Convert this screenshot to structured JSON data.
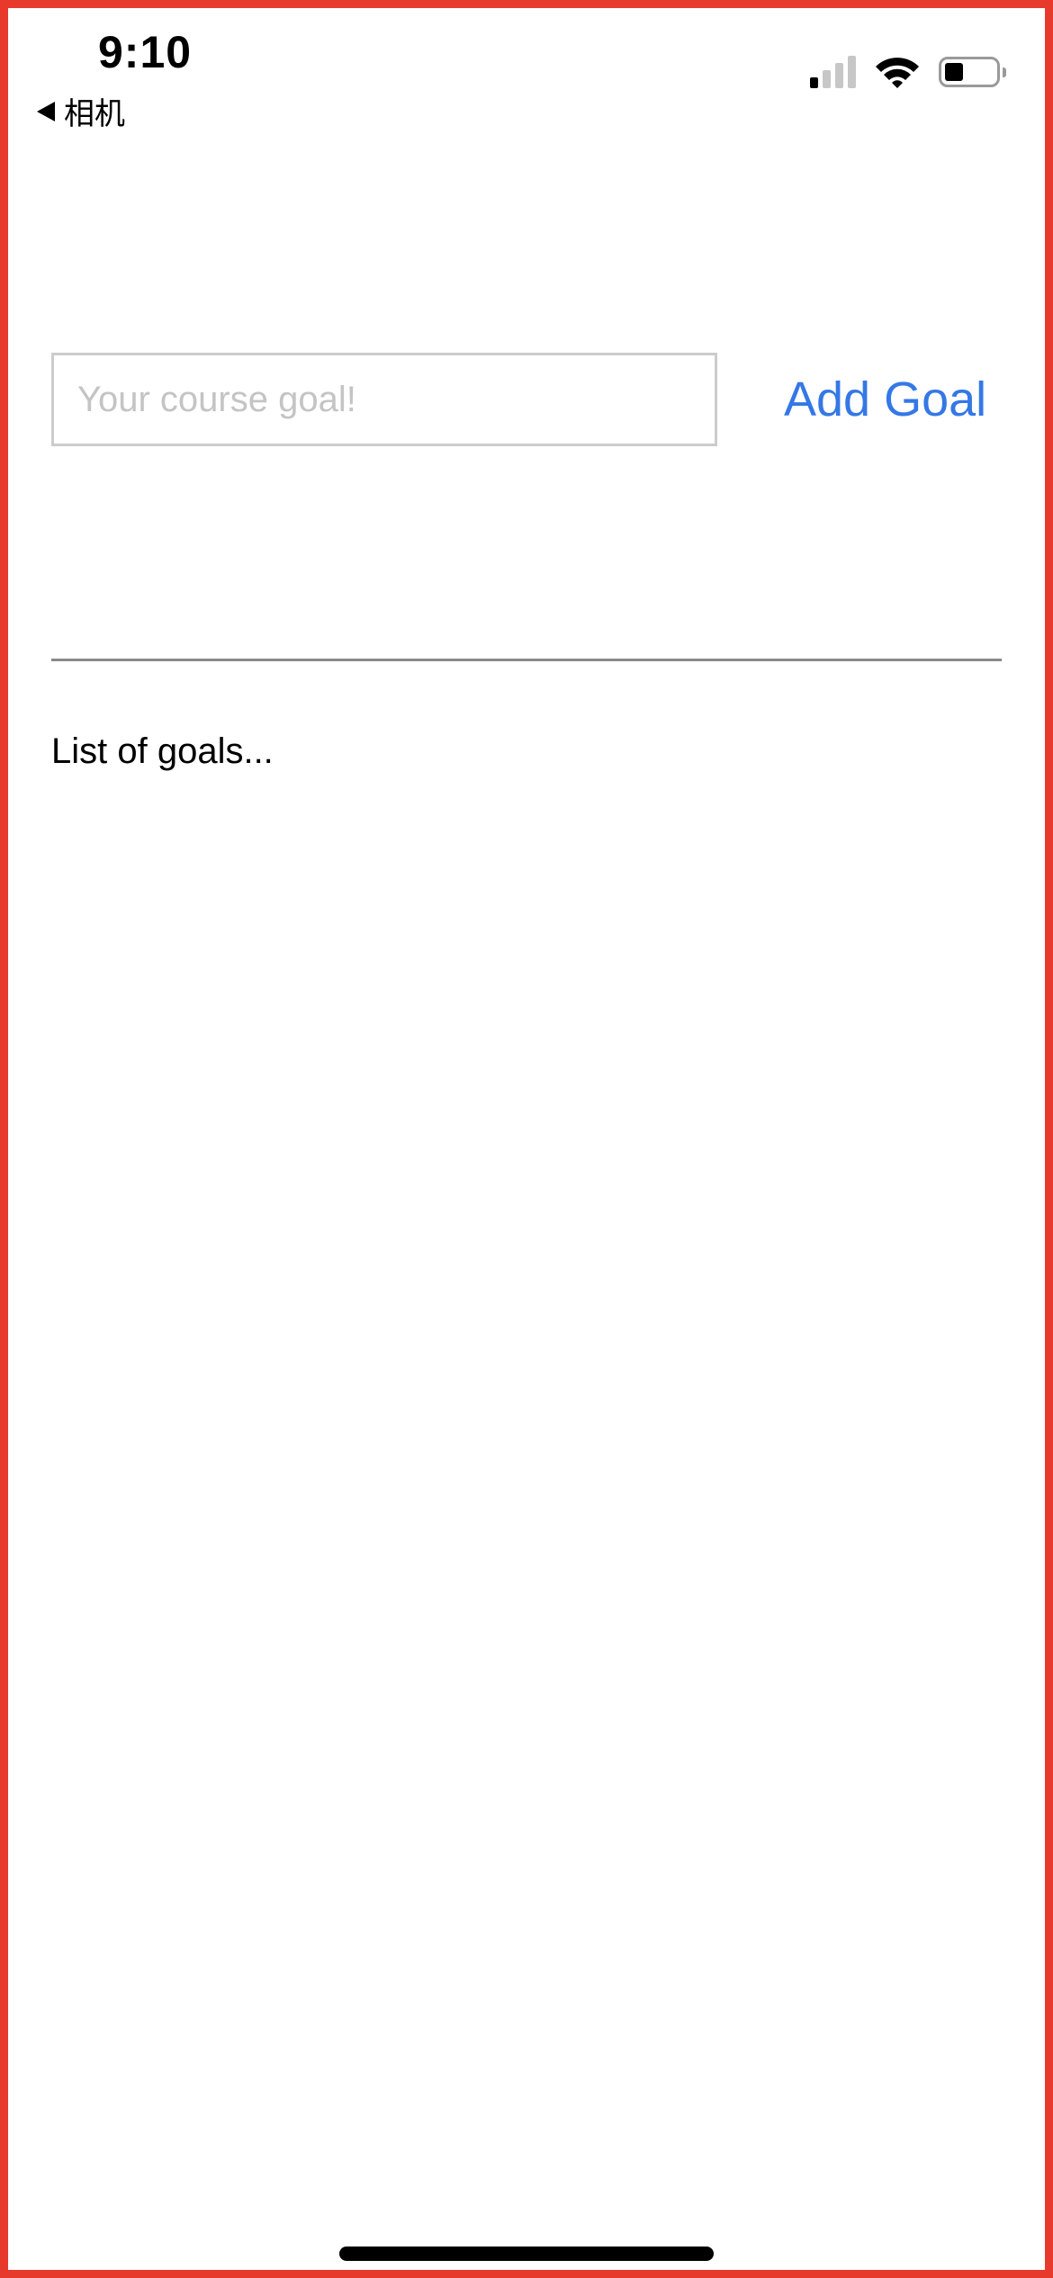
{
  "status_bar": {
    "time": "9:10",
    "back_label": "相机",
    "signal_icon": "cellular-signal-icon",
    "wifi_icon": "wifi-icon",
    "battery_icon": "battery-icon",
    "signal_bars_active": 1,
    "signal_bars_total": 4,
    "battery_level": 0.35
  },
  "goal_form": {
    "input_placeholder": "Your course goal!",
    "input_value": "",
    "add_button_label": "Add Goal"
  },
  "goals_list": {
    "heading": "List of goals..."
  },
  "colors": {
    "accent": "#3478e6",
    "frame": "#e8392d",
    "input_border": "#cccccc",
    "placeholder": "#c4c4c4",
    "divider": "#8a8a8a"
  }
}
